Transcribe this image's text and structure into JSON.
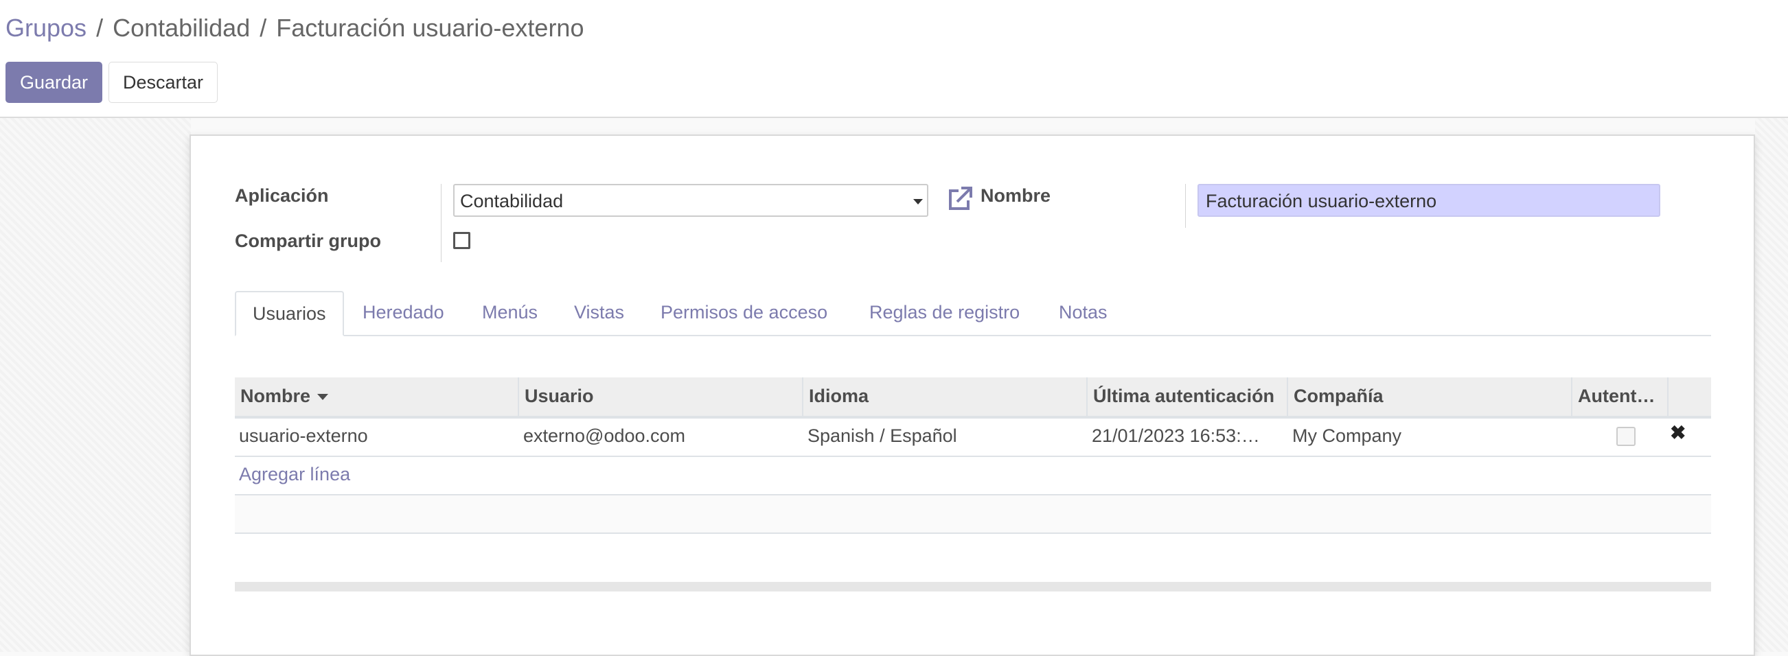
{
  "breadcrumb": {
    "root": "Grupos",
    "parent": "Contabilidad",
    "current": "Facturación usuario-externo",
    "separator": "/"
  },
  "toolbar": {
    "save_label": "Guardar",
    "discard_label": "Descartar"
  },
  "form": {
    "application_label": "Aplicación",
    "application_value": "Contabilidad",
    "share_label": "Compartir grupo",
    "share_checked": false,
    "name_label": "Nombre",
    "name_value": "Facturación usuario-externo"
  },
  "tabs": [
    {
      "label": "Usuarios",
      "active": true
    },
    {
      "label": "Heredado"
    },
    {
      "label": "Menús"
    },
    {
      "label": "Vistas"
    },
    {
      "label": "Permisos de acceso"
    },
    {
      "label": "Reglas de registro"
    },
    {
      "label": "Notas"
    }
  ],
  "users_table": {
    "columns": [
      "Nombre",
      "Usuario",
      "Idioma",
      "Última autenticación",
      "Compañía",
      "Autent…"
    ],
    "sort_column": "Nombre",
    "rows": [
      {
        "nombre": "usuario-externo",
        "usuario": "externo@odoo.com",
        "idioma": "Spanish / Español",
        "ultima_autenticacion": "21/01/2023 16:53:…",
        "compania": "My Company",
        "autent": false
      }
    ],
    "add_line_label": "Agregar línea"
  },
  "colors": {
    "accent": "#7c7bad",
    "name_highlight": "#d2d2ff"
  },
  "icons": {
    "external_link": "external-link-icon",
    "dropdown": "chevron-down-icon",
    "sort": "caret-down-icon",
    "delete": "close-icon"
  }
}
